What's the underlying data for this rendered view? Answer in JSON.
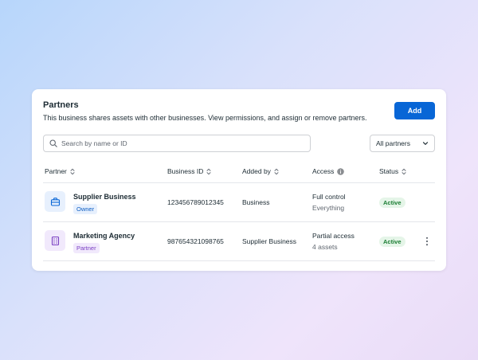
{
  "card": {
    "title": "Partners",
    "description": "This business shares assets with other businesses. View permissions, and assign or remove partners.",
    "add_label": "Add"
  },
  "search": {
    "placeholder": "Search by name or ID",
    "value": ""
  },
  "filter": {
    "selected": "All partners"
  },
  "columns": {
    "partner": "Partner",
    "business_id": "Business ID",
    "added_by": "Added by",
    "access": "Access",
    "status": "Status"
  },
  "rows": [
    {
      "name": "Supplier Business",
      "role": "Owner",
      "business_id": "123456789012345",
      "added_by": "Business",
      "access": "Full control",
      "access_detail": "Everything",
      "status": "Active",
      "icon": "briefcase-icon"
    },
    {
      "name": "Marketing Agency",
      "role": "Partner",
      "business_id": "987654321098765",
      "added_by": "Supplier Business",
      "access": "Partial access",
      "access_detail": "4 assets",
      "status": "Active",
      "icon": "building-icon"
    }
  ],
  "colors": {
    "accent": "#0866d6",
    "owner_badge_bg": "#e7f0fd",
    "owner_badge_text": "#0b5cc2",
    "partner_badge_bg": "#f1e9fc",
    "partner_badge_text": "#7a3fc2",
    "status_bg": "#e5f5e8",
    "status_text": "#1a7d33"
  }
}
